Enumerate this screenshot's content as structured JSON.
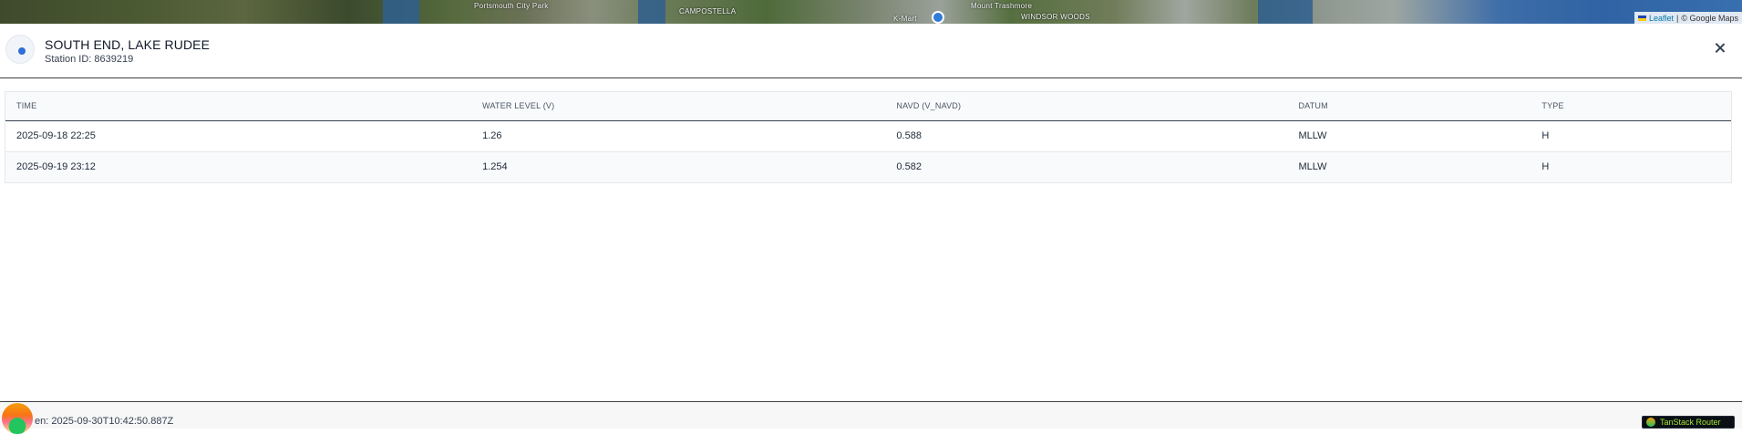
{
  "map": {
    "labels": [
      "Portsmouth City Park",
      "CAMPOSTELLA",
      "Mount Trashmore",
      "WINDSOR WOODS",
      "K-Mart"
    ],
    "attribution": {
      "leaflet": "Leaflet",
      "separator": "|",
      "google": "© Google Maps"
    }
  },
  "station": {
    "name": "SOUTH END, LAKE RUDEE",
    "id_text": "Station ID: 8639219",
    "marker_color": "#2f6fd6"
  },
  "table": {
    "columns": [
      "TIME",
      "WATER LEVEL (V)",
      "NAVD (V_NAVD)",
      "DATUM",
      "TYPE"
    ],
    "rows": [
      [
        "2025-09-18 22:25",
        "1.26",
        "0.588",
        "MLLW",
        "H"
      ],
      [
        "2025-09-19 23:12",
        "1.254",
        "0.582",
        "MLLW",
        "H"
      ]
    ]
  },
  "footer": {
    "generated_text": "en: 2025-09-30T10:42:50.887Z",
    "devtools_label": "TanStack Router"
  },
  "icons": [
    "station-dot-icon",
    "close-icon",
    "map-pin-icon",
    "leaflet-flag-icon"
  ]
}
